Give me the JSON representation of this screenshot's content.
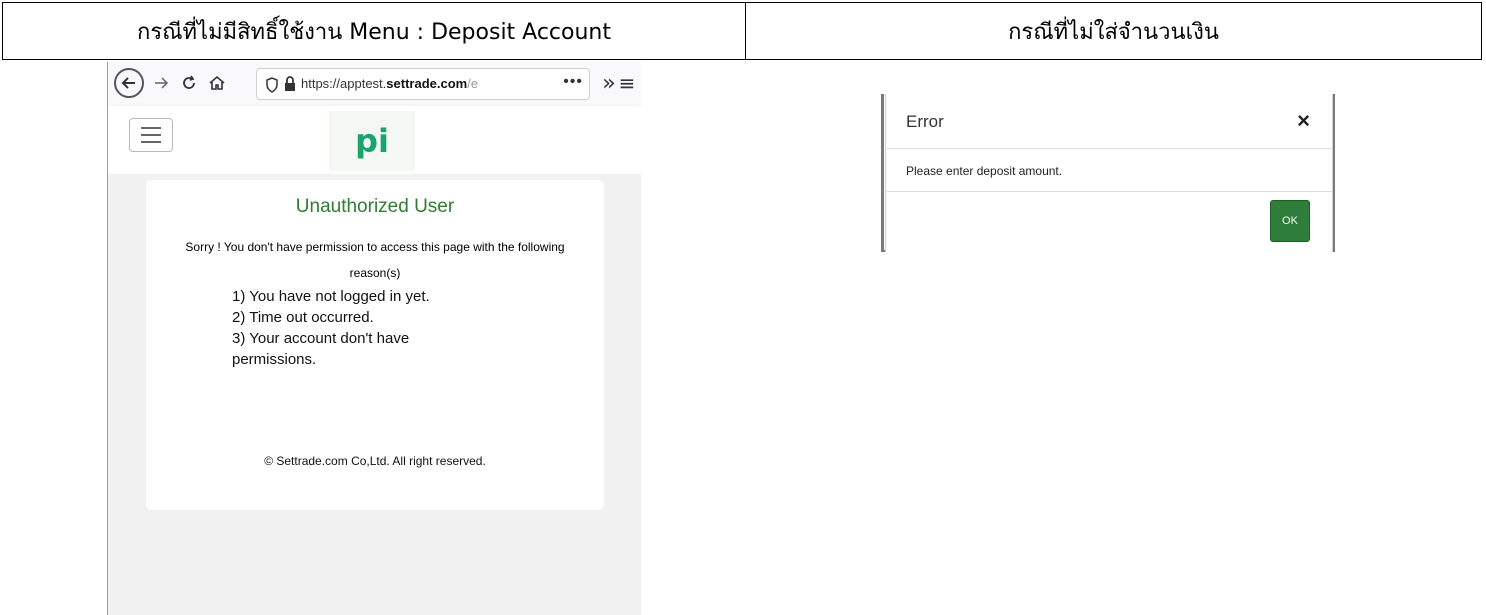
{
  "header": {
    "left_label": "กรณีที่ไม่มีสิทธิ์ใช้งาน Menu : Deposit Account",
    "right_label": "กรณีที่ไม่ใส่จำนวนเงิน"
  },
  "browser": {
    "url_prefix": "https://apptest.",
    "url_domain": "settrade.com",
    "url_suffix": "/e",
    "menu_dots": "•••",
    "overflow_glyph": "»",
    "menu_glyph": "≡",
    "logo_text": "pi",
    "brand_color": "#1aa36a"
  },
  "card": {
    "title": "Unauthorized User",
    "message_line1": "Sorry ! You don't have permission to access this page with the following",
    "message_line2": "reason(s)",
    "reasons": [
      "1) You have not logged in yet.",
      "2) Time out occurred.",
      "3) Your account don't have",
      "permissions."
    ],
    "footer": "© Settrade.com Co,Ltd. All right reserved.",
    "title_color": "#2e7d32"
  },
  "dialog": {
    "title": "Error",
    "close_glyph": "×",
    "message": "Please enter deposit amount.",
    "ok_label": "OK",
    "ok_color": "#2e7d3a"
  }
}
